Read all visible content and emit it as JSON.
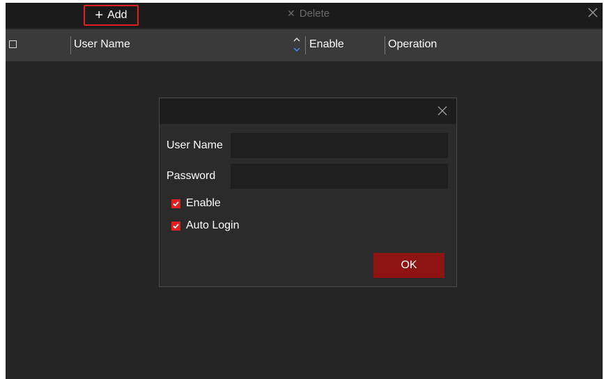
{
  "toolbar": {
    "add_label": "Add",
    "add_icon": "plus-icon",
    "delete_label": "Delete",
    "delete_icon": "x-icon",
    "close_icon": "close-icon"
  },
  "table": {
    "select_all_checked": false,
    "columns": [
      "User Name",
      "Enable",
      "Operation"
    ],
    "sort_icon": "sort-up-down-icon"
  },
  "dialog": {
    "close_icon": "close-icon",
    "user_name_label": "User Name",
    "user_name_value": "",
    "password_label": "Password",
    "password_value": "",
    "enable_label": "Enable",
    "enable_checked": true,
    "auto_login_label": "Auto Login",
    "auto_login_checked": true,
    "ok_label": "OK"
  },
  "colors": {
    "accent_red": "#e0201e",
    "ok_button": "#8e1414",
    "highlight_border": "#e02020",
    "background": "#252525"
  }
}
